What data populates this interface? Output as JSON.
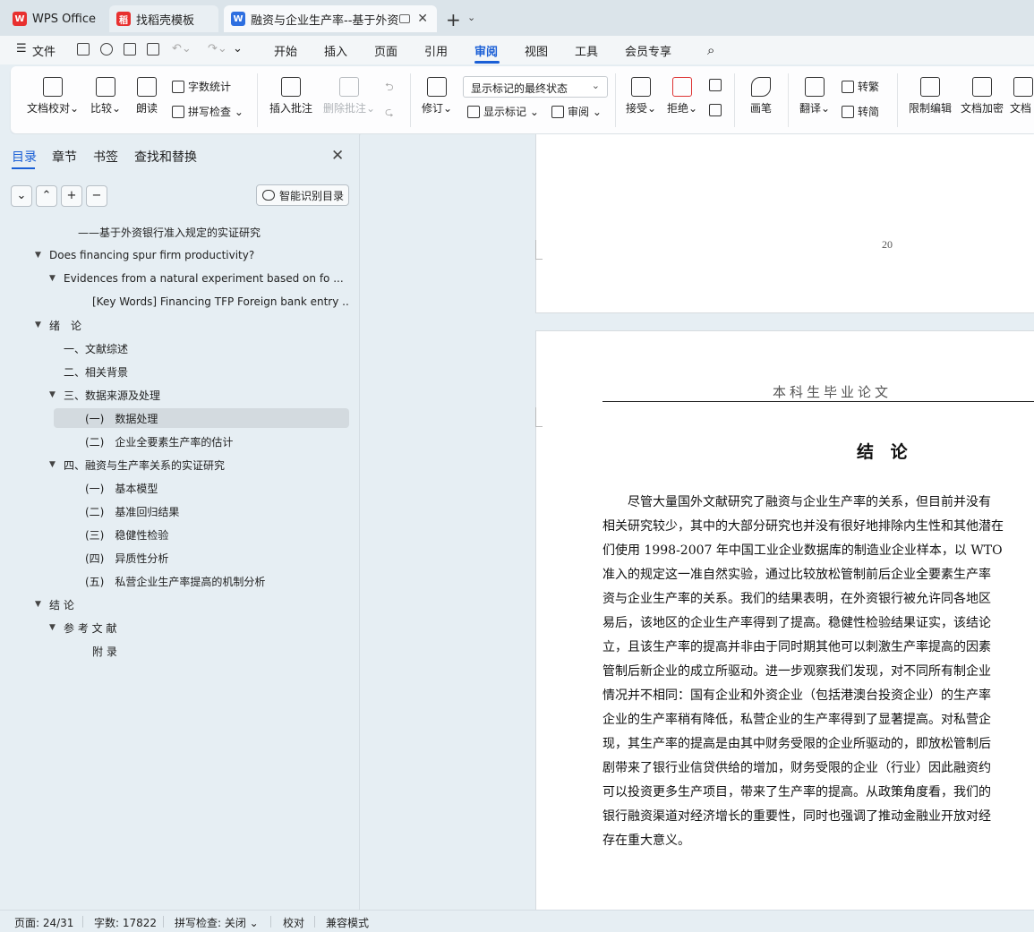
{
  "tabs": [
    {
      "label": "WPS Office",
      "logo": "W",
      "logo_color": "#e8302f"
    },
    {
      "label": "找稻壳模板",
      "logo": "稻",
      "logo_color": "#e8302f"
    },
    {
      "label": "融资与企业生产率--基于外资银",
      "logo": "W",
      "logo_color": "#2e6fe0"
    }
  ],
  "menu": {
    "file": "文件",
    "items": [
      "开始",
      "插入",
      "页面",
      "引用",
      "审阅",
      "视图",
      "工具",
      "会员专享"
    ],
    "active": "审阅"
  },
  "ribbon": {
    "proofread": "文档校对",
    "compare": "比较",
    "read_aloud": "朗读",
    "word_count": "字数统计",
    "spell_check": "拼写检查",
    "insert_comment": "插入批注",
    "delete_comment": "删除批注",
    "revise": "修订",
    "display_state": "显示标记的最终状态",
    "show_markup": "显示标记",
    "review": "审阅",
    "accept": "接受",
    "reject": "拒绝",
    "pen": "画笔",
    "translate": "翻译",
    "to_traditional": "转繁",
    "to_simplified": "转简",
    "restrict_edit": "限制编辑",
    "encrypt": "文档加密",
    "doc_more": "文档"
  },
  "nav": {
    "tabs": [
      "目录",
      "章节",
      "书签",
      "查找和替换"
    ],
    "smart_toc": "智能识别目录",
    "toc": [
      {
        "text": "——基于外资银行准入规定的实证研究",
        "level": 3,
        "arrow": false
      },
      {
        "text": "Does financing spur firm productivity?",
        "level": 1,
        "arrow": true
      },
      {
        "text": "Evidences from a natural experiment based on fo ...",
        "level": 2,
        "arrow": true
      },
      {
        "text": "[Key Words] Financing TFP Foreign bank entry ...",
        "level": 3,
        "arrow": false
      },
      {
        "text": "绪　论",
        "level": 1,
        "arrow": true
      },
      {
        "text": "一、文献综述",
        "level": 2,
        "arrow": false
      },
      {
        "text": "二、相关背景",
        "level": 2,
        "arrow": false
      },
      {
        "text": "三、数据来源及处理",
        "level": 2,
        "arrow": true
      },
      {
        "text": "(一)　数据处理",
        "level": 3,
        "arrow": false,
        "selected": true
      },
      {
        "text": "(二)　企业全要素生产率的估计",
        "level": 3,
        "arrow": false
      },
      {
        "text": "四、融资与生产率关系的实证研究",
        "level": 2,
        "arrow": true
      },
      {
        "text": "(一)　基本模型",
        "level": 3,
        "arrow": false
      },
      {
        "text": "(二)　基准回归结果",
        "level": 3,
        "arrow": false
      },
      {
        "text": "(三)　稳健性检验",
        "level": 3,
        "arrow": false
      },
      {
        "text": "(四)　异质性分析",
        "level": 3,
        "arrow": false
      },
      {
        "text": "(五)　私营企业生产率提高的机制分析",
        "level": 3,
        "arrow": false
      },
      {
        "text": "结 论",
        "level": 1,
        "arrow": true
      },
      {
        "text": "参 考 文 献",
        "level": 2,
        "arrow": true
      },
      {
        "text": "附 录",
        "level": 3,
        "arrow": false
      }
    ]
  },
  "document": {
    "page_number": "20",
    "header": "本科生毕业论文",
    "title": "结  论",
    "lines": [
      "　　尽管大量国外文献研究了融资与企业生产率的关系，但目前并没有",
      "相关研究较少，其中的大部分研究也并没有很好地排除内生性和其他潜在",
      "们使用 1998-2007 年中国工业企业数据库的制造业企业样本，以 WTO",
      "准入的规定这一准自然实验，通过比较放松管制前后企业全要素生产率",
      "资与企业生产率的关系。我们的结果表明，在外资银行被允许同各地区",
      "易后，该地区的企业生产率得到了提高。稳健性检验结果证实，该结论",
      "立，且该生产率的提高并非由于同时期其他可以刺激生产率提高的因素",
      "管制后新企业的成立所驱动。进一步观察我们发现，对不同所有制企业",
      "情况并不相同：国有企业和外资企业（包括港澳台投资企业）的生产率",
      "企业的生产率稍有降低，私营企业的生产率得到了显著提高。对私营企",
      "现，其生产率的提高是由其中财务受限的企业所驱动的，即放松管制后",
      "剧带来了银行业信贷供给的增加，财务受限的企业（行业）因此融资约",
      "可以投资更多生产项目，带来了生产率的提高。从政策角度看，我们的",
      "银行融资渠道对经济增长的重要性，同时也强调了推动金融业开放对经",
      "存在重大意义。"
    ]
  },
  "status": {
    "page": "页面: 24/31",
    "words": "字数: 17822",
    "spell": "拼写检查: 关闭",
    "proof": "校对",
    "compat": "兼容模式"
  }
}
